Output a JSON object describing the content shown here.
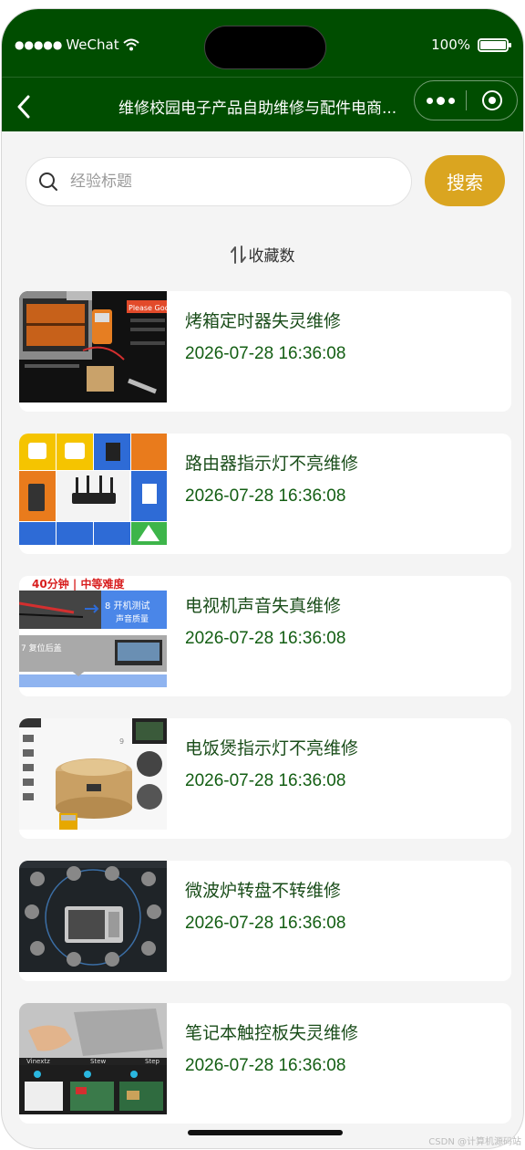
{
  "status": {
    "carrier": "WeChat",
    "battery_text": "100%"
  },
  "nav": {
    "title": "维修校园电子产品自助维修与配件电商..."
  },
  "search": {
    "placeholder": "经验标题",
    "button_label": "搜索"
  },
  "sort": {
    "label": "收藏数"
  },
  "items": [
    {
      "title": "烤箱定时器失灵维修",
      "date": "2026-07-28 16:36:08"
    },
    {
      "title": "路由器指示灯不亮维修",
      "date": "2026-07-28 16:36:08"
    },
    {
      "title": "电视机声音失真维修",
      "date": "2026-07-28 16:36:08"
    },
    {
      "title": "电饭煲指示灯不亮维修",
      "date": "2026-07-28 16:36:08"
    },
    {
      "title": "微波炉转盘不转维修",
      "date": "2026-07-28 16:36:08"
    },
    {
      "title": "笔记本触控板失灵维修",
      "date": "2026-07-28 16:36:08"
    }
  ],
  "thumb_text": {
    "oven_badge": "Please Goo",
    "tv_banner": "40分钟 | 中等难度",
    "tv_step8": "8 开机测试",
    "tv_step8_sub": "声音质量",
    "tv_step7": "7 复位后盖",
    "laptop_steps": [
      "Vinextz",
      "Stew",
      "Step"
    ]
  },
  "footer": {
    "watermark": "CSDN @计算机源码站"
  },
  "colors": {
    "header_bg": "#004d00",
    "accent": "#daa520",
    "title_text": "#1a4d1a",
    "date_text": "#135e13",
    "page_bg": "#f4f4f4"
  }
}
